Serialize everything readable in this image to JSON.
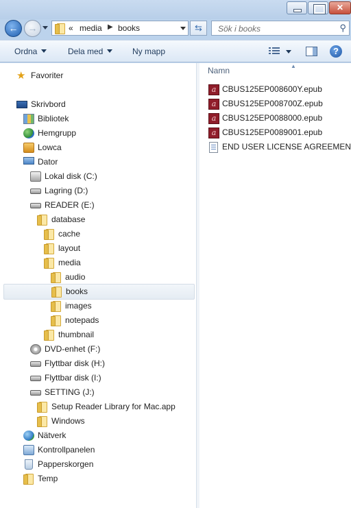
{
  "window": {
    "caption_buttons": [
      "minimize",
      "maximize",
      "close"
    ]
  },
  "address_bar": {
    "overflow": "«",
    "crumbs": [
      "media",
      "books"
    ],
    "search_placeholder": "Sök i books"
  },
  "toolbar": {
    "organize": "Ordna",
    "share": "Dela med",
    "new_folder": "Ny mapp"
  },
  "nav": {
    "favorites": "Favoriter",
    "desktop": "Skrivbord",
    "libraries": "Bibliotek",
    "homegroup": "Hemgrupp",
    "lowca": "Lowca",
    "computer": "Dator",
    "local_disk": "Lokal disk (C:)",
    "storage": "Lagring (D:)",
    "reader": "READER (E:)",
    "database": "database",
    "cache": "cache",
    "layout": "layout",
    "media": "media",
    "audio": "audio",
    "books": "books",
    "images": "images",
    "notepads": "notepads",
    "thumbnail": "thumbnail",
    "dvd": "DVD-enhet (F:)",
    "removable_h": "Flyttbar disk (H:)",
    "removable_i": "Flyttbar disk (I:)",
    "setting": "SETTING (J:)",
    "setup_app": "Setup Reader Library for Mac.app",
    "windows": "Windows",
    "network": "Nätverk",
    "control_panel": "Kontrollpanelen",
    "recycle_bin": "Papperskorgen",
    "temp": "Temp"
  },
  "content": {
    "column_name": "Namn",
    "files": [
      "CBUS125EP008600Y.epub",
      "CBUS125EP008700Z.epub",
      "CBUS125EP0088000.epub",
      "CBUS125EP0089001.epub",
      "END USER LICENSE AGREEMENT.rtf"
    ]
  }
}
